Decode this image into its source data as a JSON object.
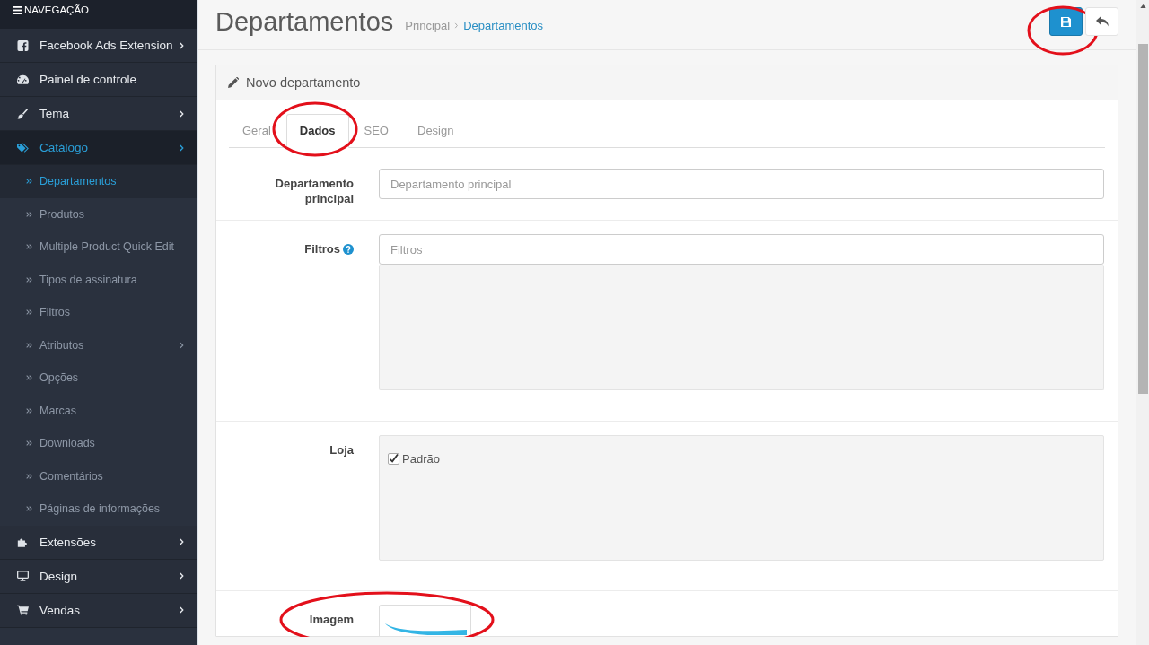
{
  "sidebar": {
    "title": "NAVEGAÇÃO",
    "items": [
      {
        "label": "Facebook Ads Extension",
        "has_submenu": true,
        "selected": false
      },
      {
        "label": "Painel de controle",
        "has_submenu": false,
        "selected": false
      },
      {
        "label": "Tema",
        "has_submenu": true,
        "selected": false
      },
      {
        "label": "Catálogo",
        "has_submenu": true,
        "selected": true,
        "children": [
          {
            "label": "Departamentos",
            "has_submenu": false,
            "selected": true
          },
          {
            "label": "Produtos",
            "has_submenu": false,
            "selected": false
          },
          {
            "label": "Multiple Product Quick Edit",
            "has_submenu": false,
            "selected": false
          },
          {
            "label": "Tipos de assinatura",
            "has_submenu": false,
            "selected": false
          },
          {
            "label": "Filtros",
            "has_submenu": false,
            "selected": false
          },
          {
            "label": "Atributos",
            "has_submenu": true,
            "selected": false
          },
          {
            "label": "Opções",
            "has_submenu": false,
            "selected": false
          },
          {
            "label": "Marcas",
            "has_submenu": false,
            "selected": false
          },
          {
            "label": "Downloads",
            "has_submenu": false,
            "selected": false
          },
          {
            "label": "Comentários",
            "has_submenu": false,
            "selected": false
          },
          {
            "label": "Páginas de informações",
            "has_submenu": false,
            "selected": false
          }
        ]
      },
      {
        "label": "Extensões",
        "has_submenu": true,
        "selected": false
      },
      {
        "label": "Design",
        "has_submenu": true,
        "selected": false
      },
      {
        "label": "Vendas",
        "has_submenu": true,
        "selected": false
      }
    ]
  },
  "header": {
    "title": "Departamentos",
    "breadcrumb": [
      {
        "label": "Principal",
        "current": false
      },
      {
        "label": "Departamentos",
        "current": true
      }
    ],
    "buttons": [
      {
        "kind": "save",
        "circled": true
      },
      {
        "kind": "back",
        "circled": false
      }
    ]
  },
  "panel": {
    "title": "Novo departamento",
    "tabs": [
      {
        "label": "Geral",
        "selected": false,
        "circled": false
      },
      {
        "label": "Dados",
        "selected": true,
        "circled": true
      },
      {
        "label": "SEO",
        "selected": false,
        "circled": false
      },
      {
        "label": "Design",
        "selected": false,
        "circled": false
      }
    ],
    "fields": [
      {
        "kind": "text",
        "label": "Departamento principal",
        "help": false,
        "placeholder": "Departamento principal",
        "circled": false
      },
      {
        "kind": "autocomplete",
        "label": "Filtros",
        "help": true,
        "placeholder": "Filtros",
        "circled": false
      },
      {
        "kind": "checklist",
        "label": "Loja",
        "help": false,
        "options": [
          {
            "label": "Padrão",
            "checked": true
          }
        ],
        "circled": false
      },
      {
        "kind": "image",
        "label": "Imagem",
        "help": false,
        "circled": true
      }
    ]
  }
}
